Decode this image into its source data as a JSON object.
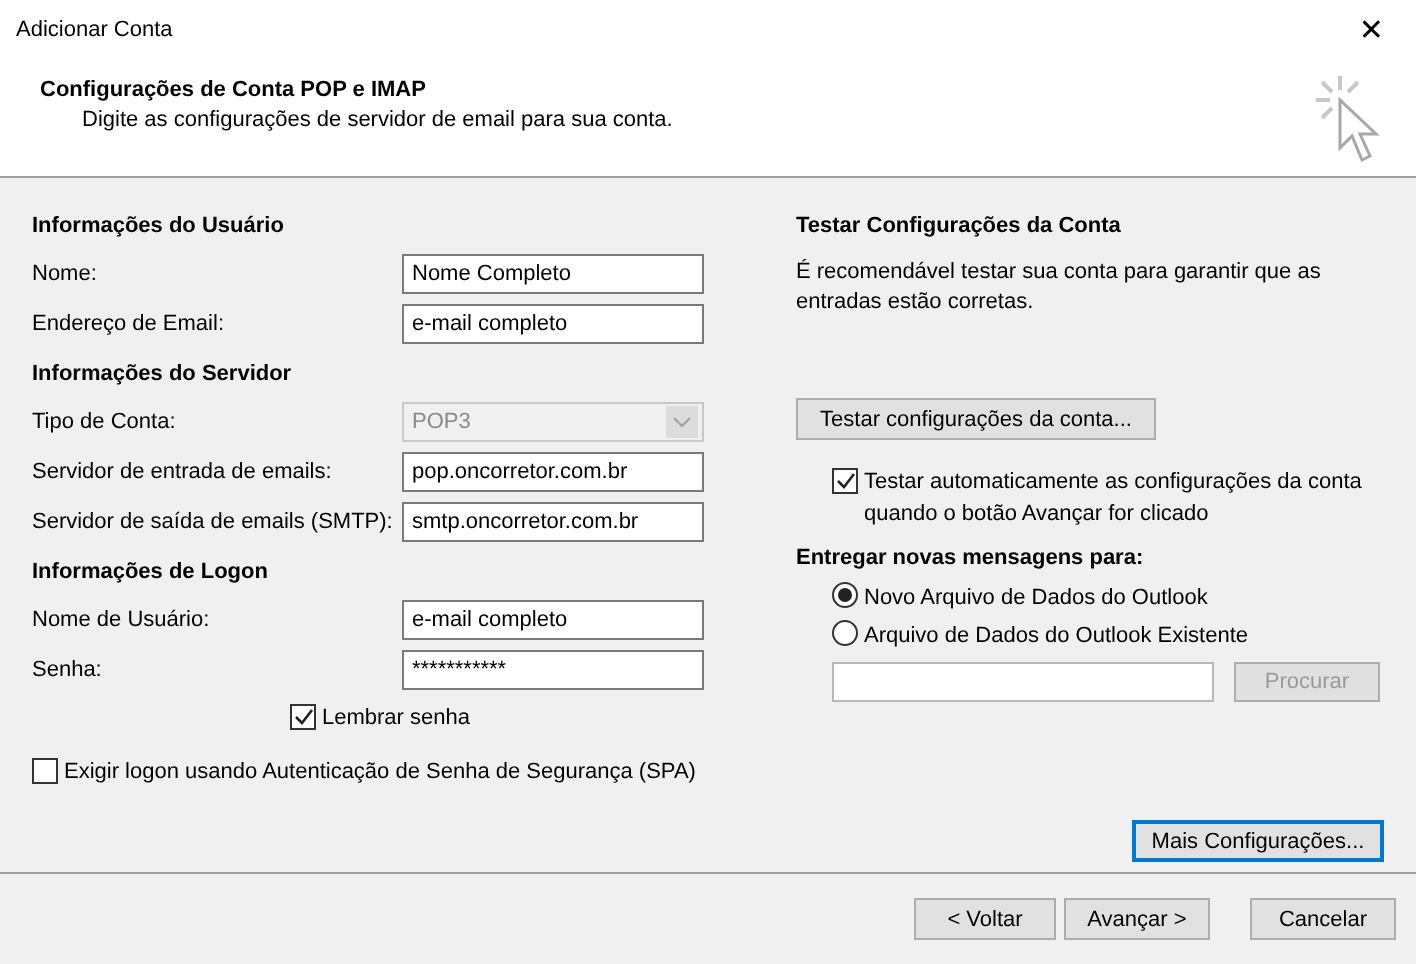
{
  "window": {
    "title": "Adicionar Conta",
    "close": "✕"
  },
  "header": {
    "title": "Configurações de Conta POP e IMAP",
    "subtitle": "Digite as configurações de servidor de email para sua conta."
  },
  "sections": [
    {
      "title": "Informações do Usuário",
      "fields": [
        {
          "kind": "text",
          "label": "Nome:",
          "value": "Nome Completo"
        },
        {
          "kind": "text",
          "label": "Endereço de Email:",
          "value": "e-mail completo"
        }
      ]
    },
    {
      "title": "Informações do Servidor",
      "fields": [
        {
          "kind": "select",
          "label": "Tipo de Conta:",
          "value": "POP3",
          "disabled": true
        },
        {
          "kind": "text",
          "label": "Servidor de entrada de emails:",
          "value": "pop.oncorretor.com.br"
        },
        {
          "kind": "text",
          "label": "Servidor de saída de emails (SMTP):",
          "value": "smtp.oncorretor.com.br"
        }
      ]
    },
    {
      "title": "Informações de Logon",
      "fields": [
        {
          "kind": "text",
          "label": "Nome de Usuário:",
          "value": "e-mail completo"
        },
        {
          "kind": "text",
          "label": "Senha:",
          "value": "***********"
        }
      ]
    }
  ],
  "remember_password": {
    "label": "Lembrar senha",
    "checked": true
  },
  "spa": {
    "label": "Exigir logon usando Autenticação de Senha de Segurança (SPA)",
    "checked": false
  },
  "test": {
    "title": "Testar Configurações da Conta",
    "description": "É recomendável testar sua conta para garantir que as entradas estão corretas.",
    "button": "Testar configurações da conta...",
    "auto": {
      "label": "Testar automaticamente as configurações da conta quando o botão Avançar for clicado",
      "checked": true
    }
  },
  "deliver": {
    "title": "Entregar novas mensagens para:",
    "options": [
      {
        "label": "Novo Arquivo de Dados do Outlook",
        "selected": true
      },
      {
        "label": "Arquivo de Dados do Outlook Existente",
        "selected": false
      }
    ],
    "browse": {
      "label": "Procurar",
      "disabled": true
    }
  },
  "more_button": "Mais Configurações...",
  "buttons": [
    {
      "label": "< Voltar"
    },
    {
      "label": "Avançar >"
    },
    {
      "label": "Cancelar"
    }
  ]
}
